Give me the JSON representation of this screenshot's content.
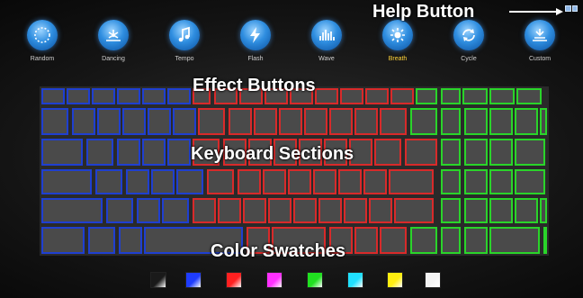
{
  "annotations": {
    "help": "Help Button",
    "effects": "Effect Buttons",
    "keyboard": "Keyboard Sections",
    "swatches": "Color Swatches"
  },
  "effects": [
    {
      "label": "Random",
      "icon": "random-icon",
      "active": false
    },
    {
      "label": "Dancing",
      "icon": "dancing-icon",
      "active": false
    },
    {
      "label": "Tempo",
      "icon": "music-note-icon",
      "active": false
    },
    {
      "label": "Flash",
      "icon": "lightning-icon",
      "active": false
    },
    {
      "label": "Wave",
      "icon": "wave-bars-icon",
      "active": false
    },
    {
      "label": "Breath",
      "icon": "sun-icon",
      "active": true
    },
    {
      "label": "Cycle",
      "icon": "cycle-icon",
      "active": false
    },
    {
      "label": "Custom",
      "icon": "custom-icon",
      "active": false
    }
  ],
  "sections": {
    "left": {
      "name": "left",
      "color": "#1f3fd0"
    },
    "center": {
      "name": "center",
      "color": "#d82a2a"
    },
    "right": {
      "name": "right",
      "color": "#2ad42a"
    }
  },
  "swatches": [
    {
      "name": "black",
      "color": "#1a1a1a"
    },
    {
      "name": "blue",
      "color": "#1e3cff"
    },
    {
      "name": "red",
      "color": "#ff2020"
    },
    {
      "name": "magenta",
      "color": "#ff30ff"
    },
    {
      "name": "green",
      "color": "#20e020"
    },
    {
      "name": "cyan",
      "color": "#20e0ff"
    },
    {
      "name": "yellow",
      "color": "#ffee10"
    },
    {
      "name": "white",
      "color": "#f4f4f4"
    }
  ]
}
